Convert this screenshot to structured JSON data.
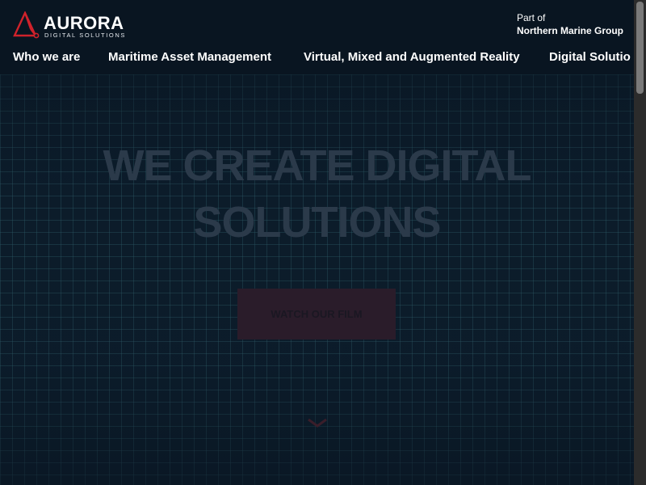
{
  "brand": {
    "name": "AURORA",
    "tagline": "DIGITAL SOLUTIONS",
    "accent_color": "#d0222b",
    "logo_icon": "triangle-logo-icon"
  },
  "parent_group": {
    "prefix": "Part of",
    "name": "Northern Marine Group"
  },
  "nav": {
    "items": [
      {
        "label": "Who we are"
      },
      {
        "label": "Maritime Asset Management"
      },
      {
        "label": "Virtual, Mixed and Augmented Reality"
      },
      {
        "label": "Digital Solutio"
      }
    ]
  },
  "hero": {
    "headline_line1": "WE CREATE DIGITAL",
    "headline_line2": "SOLUTIONS",
    "cta_label": "WATCH OUR FILM",
    "scroll_icon": "chevron-down-icon"
  }
}
